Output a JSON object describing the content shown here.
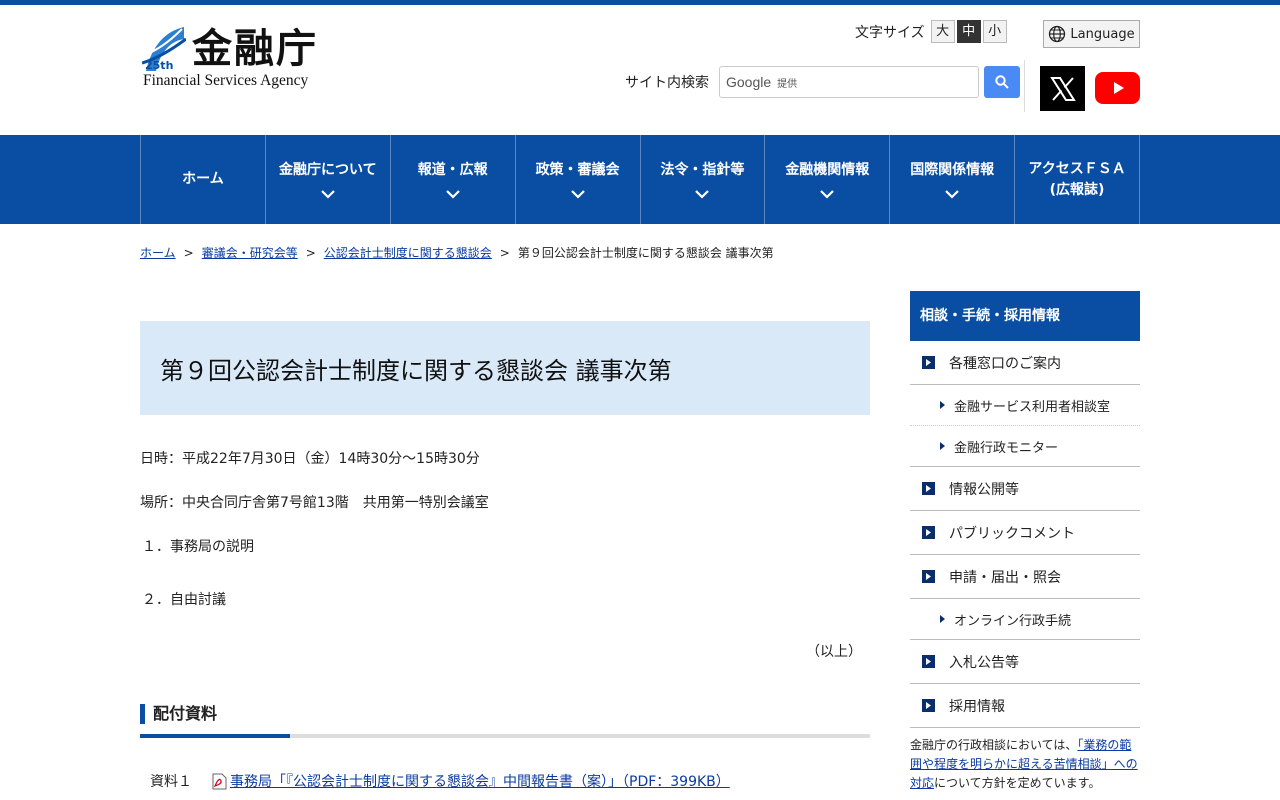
{
  "header": {
    "logo_jp": "金融庁",
    "logo_en": "Financial Services Agency",
    "logo_badge": "25th",
    "fontsize_label": "文字サイズ",
    "fontsize_options": [
      "大",
      "中",
      "小"
    ],
    "language_label": "Language",
    "search_label": "サイト内検索",
    "search_google": "Google",
    "search_provided": "提供"
  },
  "nav": {
    "items": [
      {
        "label": "ホーム"
      },
      {
        "label": "金融庁について"
      },
      {
        "label": "報道・広報"
      },
      {
        "label": "政策・審議会"
      },
      {
        "label": "法令・指針等"
      },
      {
        "label": "金融機関情報"
      },
      {
        "label": "国際関係情報"
      },
      {
        "label": "アクセスＦＳＡ",
        "label2": "(広報誌)"
      }
    ]
  },
  "breadcrumb": {
    "items": [
      "ホーム",
      "審議会・研究会等",
      "公認会計士制度に関する懇談会"
    ],
    "current": "第９回公認会計士制度に関する懇談会 議事次第",
    "separator": ">"
  },
  "main": {
    "title": "第９回公認会計士制度に関する懇談会 議事次第",
    "datetime": "日時：平成22年7月30日（金）14時30分～15時30分",
    "place": "場所：中央合同庁舎第7号館13階　共用第一特別会議室",
    "item1": "１．事務局の説明",
    "item2": "２．自由討議",
    "ijo": "（以上）",
    "section_heading": "配付資料",
    "docs": [
      {
        "num": "資料１",
        "link": "事務局「『公認会計士制度に関する懇談会』中間報告書（案）」（PDF：399KB）"
      }
    ]
  },
  "sidebar": {
    "heading": "相談・手続・採用情報",
    "items": [
      {
        "label": "各種窓口のご案内",
        "level": 1
      },
      {
        "label": "金融サービス利用者相談室",
        "level": 2
      },
      {
        "label": "金融行政モニター",
        "level": 2
      },
      {
        "label": "情報公開等",
        "level": 1
      },
      {
        "label": "パブリックコメント",
        "level": 1
      },
      {
        "label": "申請・届出・照会",
        "level": 1
      },
      {
        "label": "オンライン行政手続",
        "level": 2
      },
      {
        "label": "入札公告等",
        "level": 1
      },
      {
        "label": "採用情報",
        "level": 1
      }
    ],
    "note_prefix": "金融庁の行政相談においては、",
    "note_link": "「業務の範囲や程度を明らかに超える苦情相談」への対応",
    "note_suffix": "について方針を定めています。"
  },
  "colors": {
    "brand": "#0a4ea3",
    "title_bg": "#d9e9f7",
    "link": "#0a3aa0"
  }
}
